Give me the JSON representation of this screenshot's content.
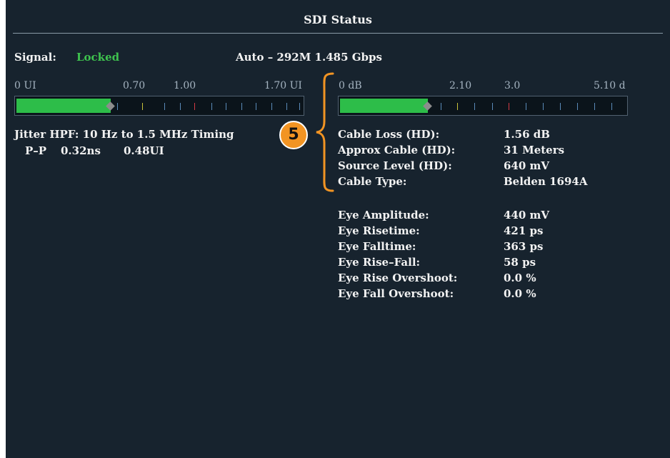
{
  "title": "SDI Status",
  "signal": {
    "label": "Signal:",
    "value": "Locked",
    "format": "Auto – 292M 1.485 Gbps"
  },
  "jitter_meter": {
    "scale": [
      "0 UI",
      "0.70",
      "1.00",
      "1.70 UI"
    ],
    "level_ui": 0.56,
    "max_ui": 1.7
  },
  "cable_meter": {
    "scale": [
      "0 dB",
      "2.10",
      "3.0",
      "5.10 d"
    ],
    "level_db": 1.56,
    "max_db": 5.1
  },
  "jitter": {
    "heading": "Jitter HPF: 10 Hz to 1.5 MHz Timing",
    "pp_label": "P–P",
    "pp_ns": "0.32ns",
    "pp_ui": "0.48UI"
  },
  "callout_number": "5",
  "cable_rows": [
    {
      "label": "Cable Loss (HD):",
      "value": "1.56 dB"
    },
    {
      "label": "Approx Cable (HD):",
      "value": "31 Meters"
    },
    {
      "label": "Source Level (HD):",
      "value": "640 mV"
    },
    {
      "label": "Cable Type:",
      "value": "Belden 1694A"
    }
  ],
  "eye_rows": [
    {
      "label": "Eye Amplitude:",
      "value": "440 mV"
    },
    {
      "label": "Eye Risetime:",
      "value": "421 ps"
    },
    {
      "label": "Eye Falltime:",
      "value": "363 ps"
    },
    {
      "label": "Eye Rise–Fall:",
      "value": "58 ps"
    },
    {
      "label": "Eye Rise Overshoot:",
      "value": "0.0 %"
    },
    {
      "label": "Eye Fall Overshoot:",
      "value": "0.0 %"
    }
  ],
  "colors": {
    "background": "#17232e",
    "meter_fill": "#2dbd49",
    "locked": "#3ec24e",
    "callout": "#f29423"
  }
}
